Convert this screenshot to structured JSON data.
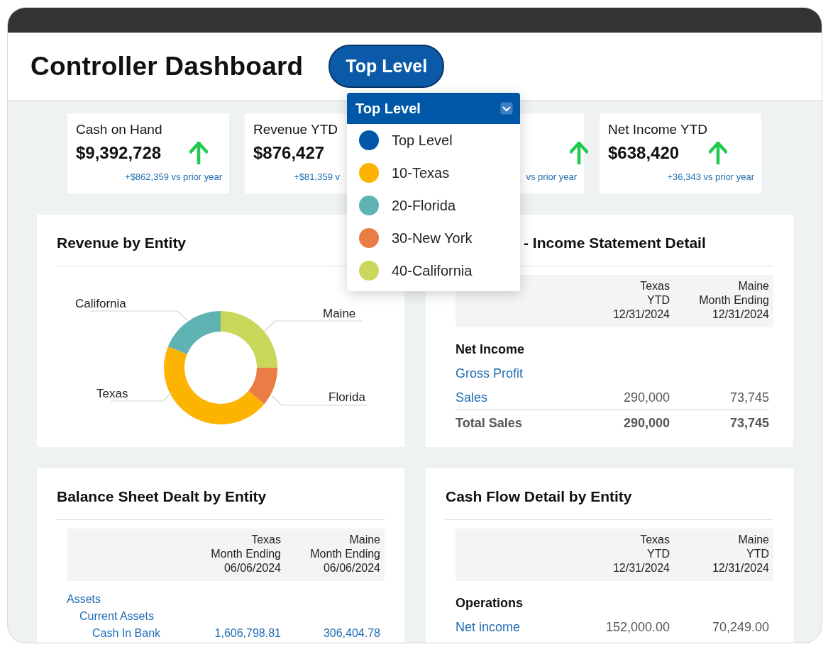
{
  "header": {
    "title": "Controller Dashboard",
    "level_button": "Top Level"
  },
  "kpis": [
    {
      "label": "Cash on Hand",
      "value": "$9,392,728",
      "change": "+$862,359 vs prior year"
    },
    {
      "label": "Revenue YTD",
      "value": "$876,427",
      "change": "+$81,359 v"
    },
    {
      "change": "vs prior year"
    },
    {
      "label": "Net Income YTD",
      "value": "$638,420",
      "change": "+36,343 vs prior year"
    }
  ],
  "dropdown": {
    "label": "Top Level",
    "options": [
      {
        "label": "Top Level",
        "color": "#0057a8"
      },
      {
        "label": "10-Texas",
        "color": "#fdb400"
      },
      {
        "label": "20-Florida",
        "color": "#5fb3b3"
      },
      {
        "label": "30-New York",
        "color": "#ea7d45"
      },
      {
        "label": "40-California",
        "color": "#c9d85a"
      }
    ]
  },
  "revenue_chart": {
    "title": "Revenue by Entity",
    "labels": [
      "California",
      "Maine",
      "Texas",
      "Florida"
    ]
  },
  "income_statement": {
    "title": "- Income Statement Detail",
    "columns": [
      [
        "Texas",
        "YTD",
        "12/31/2024"
      ],
      [
        "Maine",
        "Month Ending",
        "12/31/2024"
      ]
    ],
    "rows": [
      {
        "kind": "section",
        "label": "Net Income"
      },
      {
        "kind": "link",
        "label": "Gross Profit"
      },
      {
        "kind": "link",
        "label": "Sales",
        "values": [
          "290,000",
          "73,745"
        ]
      },
      {
        "kind": "total",
        "label": "Total Sales",
        "values": [
          "290,000",
          "73,745"
        ]
      }
    ]
  },
  "balance_sheet": {
    "title": "Balance Sheet Dealt by Entity",
    "columns": [
      [
        "Texas",
        "Month Ending",
        "06/06/2024"
      ],
      [
        "Maine",
        "Month Ending",
        "06/06/2024"
      ]
    ],
    "rows": [
      {
        "kind": "account",
        "label": "Assets",
        "children": [
          {
            "kind": "account",
            "label": "Current Assets",
            "children": [
              {
                "kind": "account",
                "label": "Cash In Bank",
                "values": [
                  "1,606,798.81",
                  "306,404.78"
                ]
              }
            ]
          }
        ]
      }
    ]
  },
  "cash_flow": {
    "title": "Cash Flow Detail by Entity",
    "columns": [
      [
        "Texas",
        "YTD",
        "12/31/2024"
      ],
      [
        "Maine",
        "YTD",
        "12/31/2024"
      ]
    ],
    "rows": [
      {
        "kind": "section",
        "label": "Operations"
      },
      {
        "kind": "link",
        "label": "Net income",
        "values": [
          "152,000.00",
          "70,249.00"
        ]
      }
    ]
  }
}
